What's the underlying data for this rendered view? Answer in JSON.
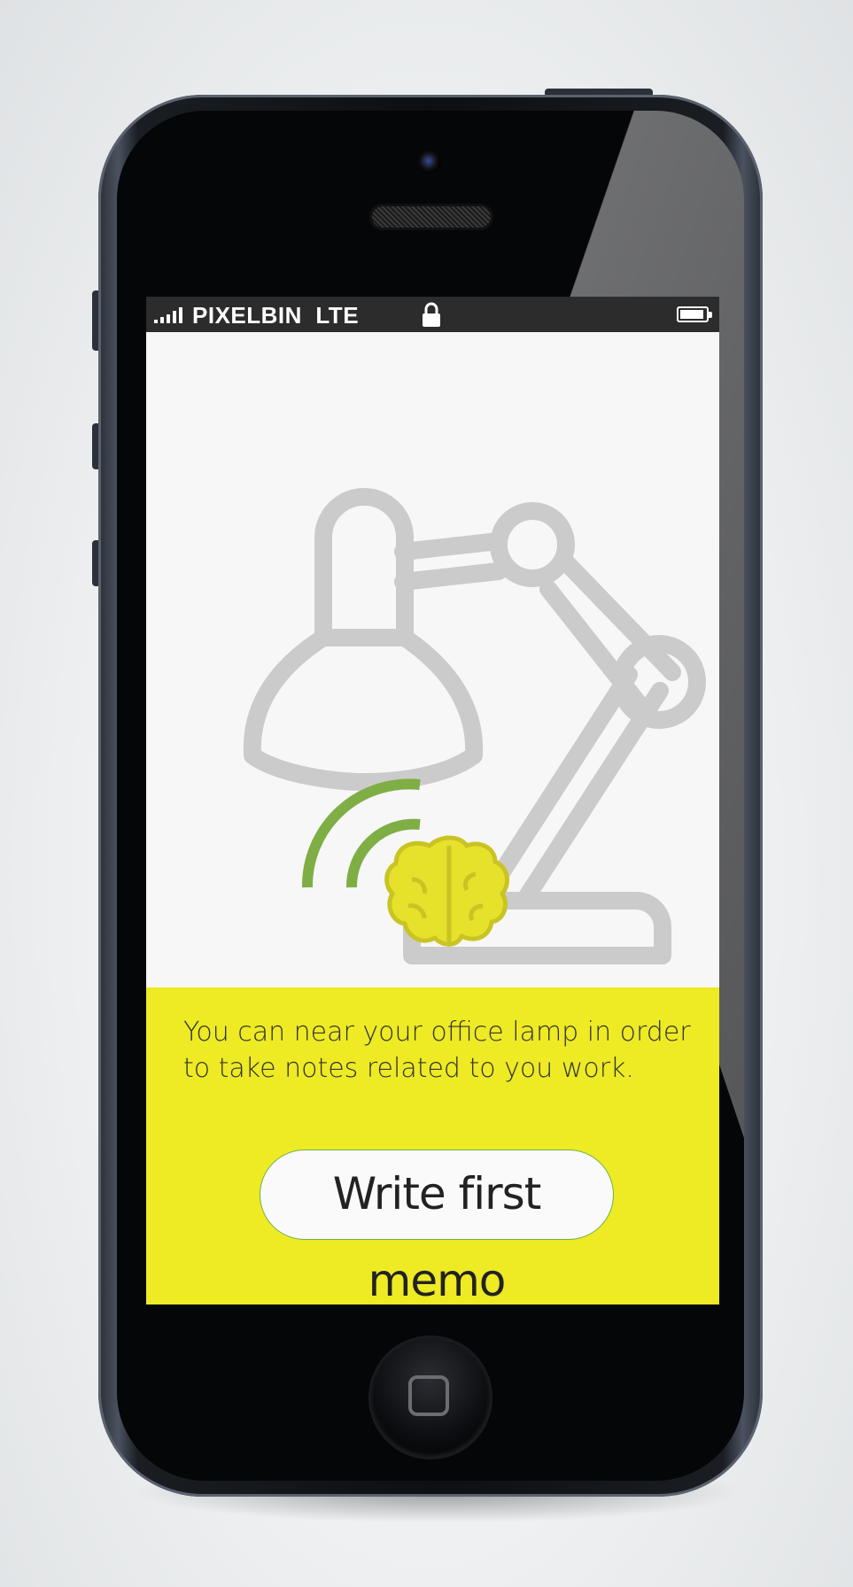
{
  "status_bar": {
    "carrier": "PIXELBIN  LTE",
    "signal_icon": "signal-bars-icon",
    "lock_icon": "lock-icon",
    "battery_icon": "battery-icon"
  },
  "illustration": {
    "lamp_icon": "desk-lamp-icon",
    "brain_icon": "brain-icon",
    "signal_waves_icon": "signal-waves-icon"
  },
  "panel": {
    "description": "You can near your office lamp in order to take notes related to you work.",
    "button_label": "Write first memo"
  },
  "colors": {
    "panel_bg": "#eeea24",
    "wave_green": "#7fae45",
    "brain_yellow": "#e6e12a",
    "lamp_gray": "#cbcbcb"
  }
}
